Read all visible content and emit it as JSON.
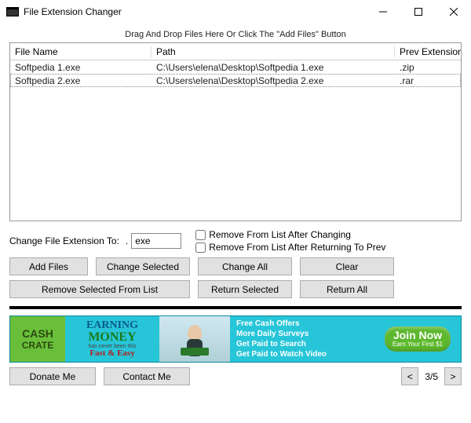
{
  "window": {
    "title": "File Extension Changer"
  },
  "drag_hint": "Drag And Drop Files Here Or Click The \"Add Files\" Button",
  "columns": {
    "name": "File Name",
    "path": "Path",
    "prev": "Prev Extension"
  },
  "rows": [
    {
      "name": "Softpedia 1.exe",
      "path": "C:\\Users\\elena\\Desktop\\Softpedia 1.exe",
      "prev": ".zip"
    },
    {
      "name": "Softpedia 2.exe",
      "path": "C:\\Users\\elena\\Desktop\\Softpedia 2.exe",
      "prev": ".rar"
    }
  ],
  "ext": {
    "label": "Change File Extension To:",
    "dot": ".",
    "value": "exe"
  },
  "checks": {
    "remove_after_change": "Remove From List After Changing",
    "remove_after_return": "Remove From List After Returning To Prev"
  },
  "buttons": {
    "add_files": "Add Files",
    "change_selected": "Change Selected",
    "change_all": "Change All",
    "clear": "Clear",
    "remove_selected": "Remove Selected From List",
    "return_selected": "Return Selected",
    "return_all": "Return All",
    "donate": "Donate Me",
    "contact": "Contact Me"
  },
  "ad": {
    "crate1": "CASH",
    "crate2": "CRATE",
    "earning": "EARNING",
    "money": "MONEY",
    "never": "has never been this",
    "fast": "Fast & Easy",
    "list1": "Free Cash Offers",
    "list2": "More Daily Surveys",
    "list3": "Get Paid to Search",
    "list4": "Get Paid to Watch Video",
    "join1": "Join Now",
    "join2": "Earn Your First $1"
  },
  "pager": {
    "prev": "<",
    "page": "3/5",
    "next": ">"
  }
}
